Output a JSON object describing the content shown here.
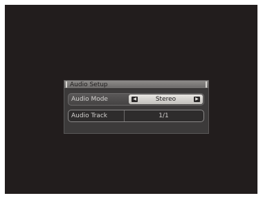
{
  "dialog": {
    "title": "Audio Setup"
  },
  "settings": [
    {
      "label": "Audio Mode",
      "value": "Stereo",
      "selected": true,
      "left_arrow_icon": "triangle-left-icon",
      "right_arrow_icon": "triangle-right-icon"
    },
    {
      "label": "Audio Track",
      "value": "1/1",
      "selected": false
    }
  ],
  "colors": {
    "background": "#221d1d",
    "dialog": "#3c3a3a",
    "title_bar": "#7d7b79",
    "value_highlight": "#dcdad6",
    "text": "#d4d2d0"
  }
}
